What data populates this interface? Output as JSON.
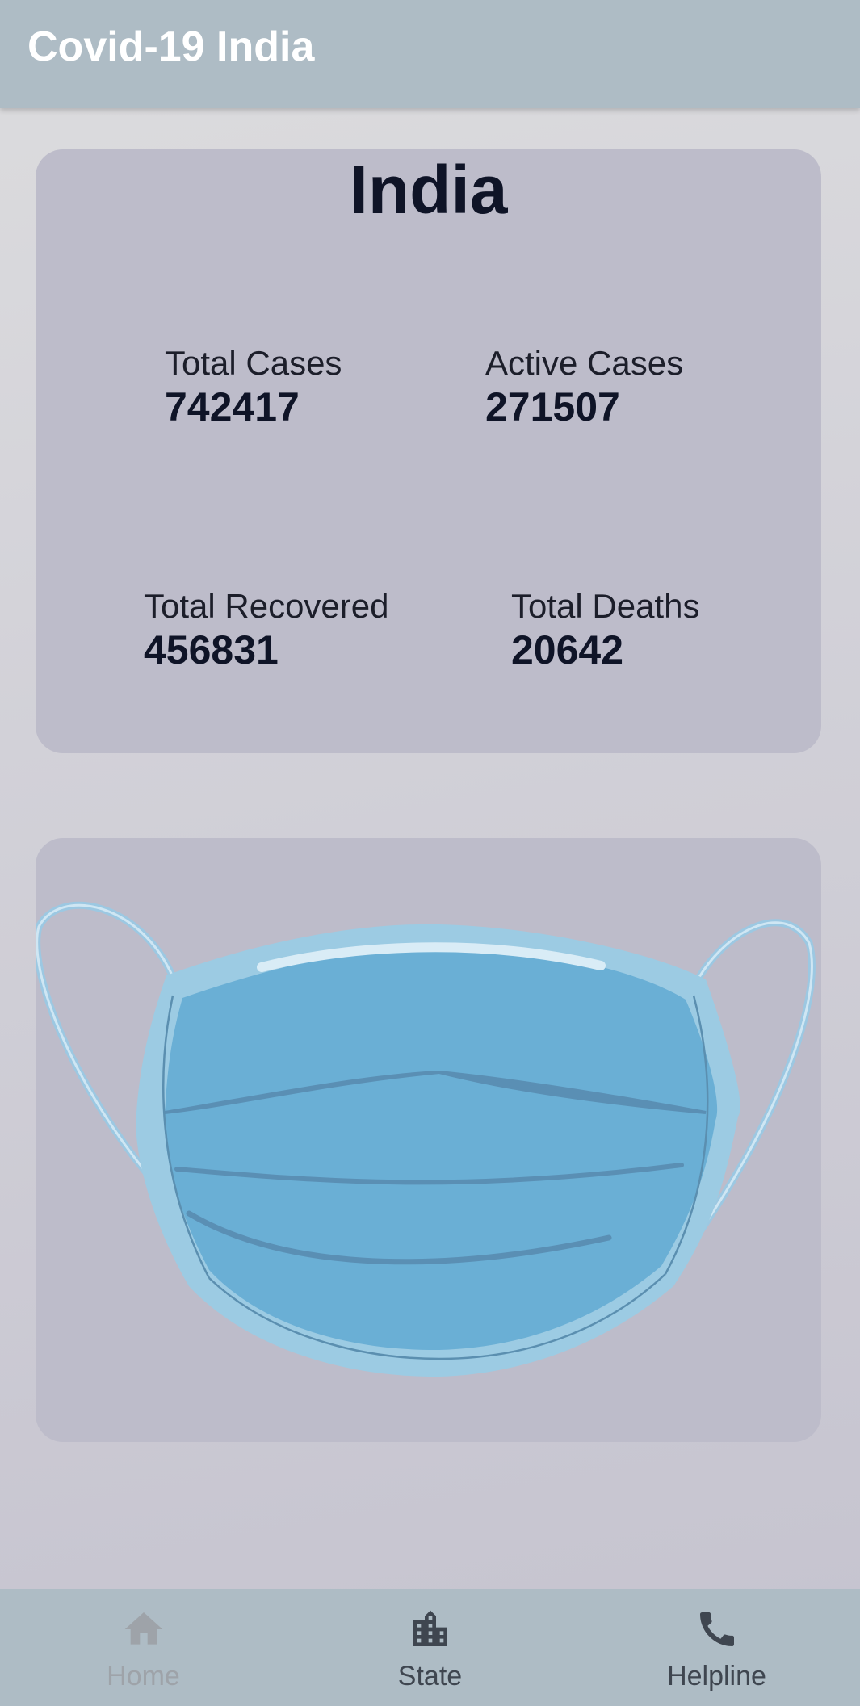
{
  "app_bar": {
    "title": "Covid-19 India"
  },
  "summary": {
    "country": "India",
    "stats": [
      {
        "label": "Total Cases",
        "value": "742417"
      },
      {
        "label": "Active Cases",
        "value": "271507"
      },
      {
        "label": "Total Recovered",
        "value": "456831"
      },
      {
        "label": "Total Deaths",
        "value": "20642"
      }
    ]
  },
  "illustration": {
    "icon": "face-mask-icon"
  },
  "bottom_nav": {
    "items": [
      {
        "label": "Home",
        "icon": "home-icon",
        "selected": false,
        "color": "#9ea3a9"
      },
      {
        "label": "State",
        "icon": "building-icon",
        "selected": true,
        "color": "#3f4650"
      },
      {
        "label": "Helpline",
        "icon": "phone-icon",
        "selected": true,
        "color": "#3f4650"
      }
    ]
  },
  "colors": {
    "app_bar": "#aebcc5",
    "card": "#bdbcca",
    "text_dark": "#0f1427",
    "mask_blue": "#6aafd5"
  }
}
